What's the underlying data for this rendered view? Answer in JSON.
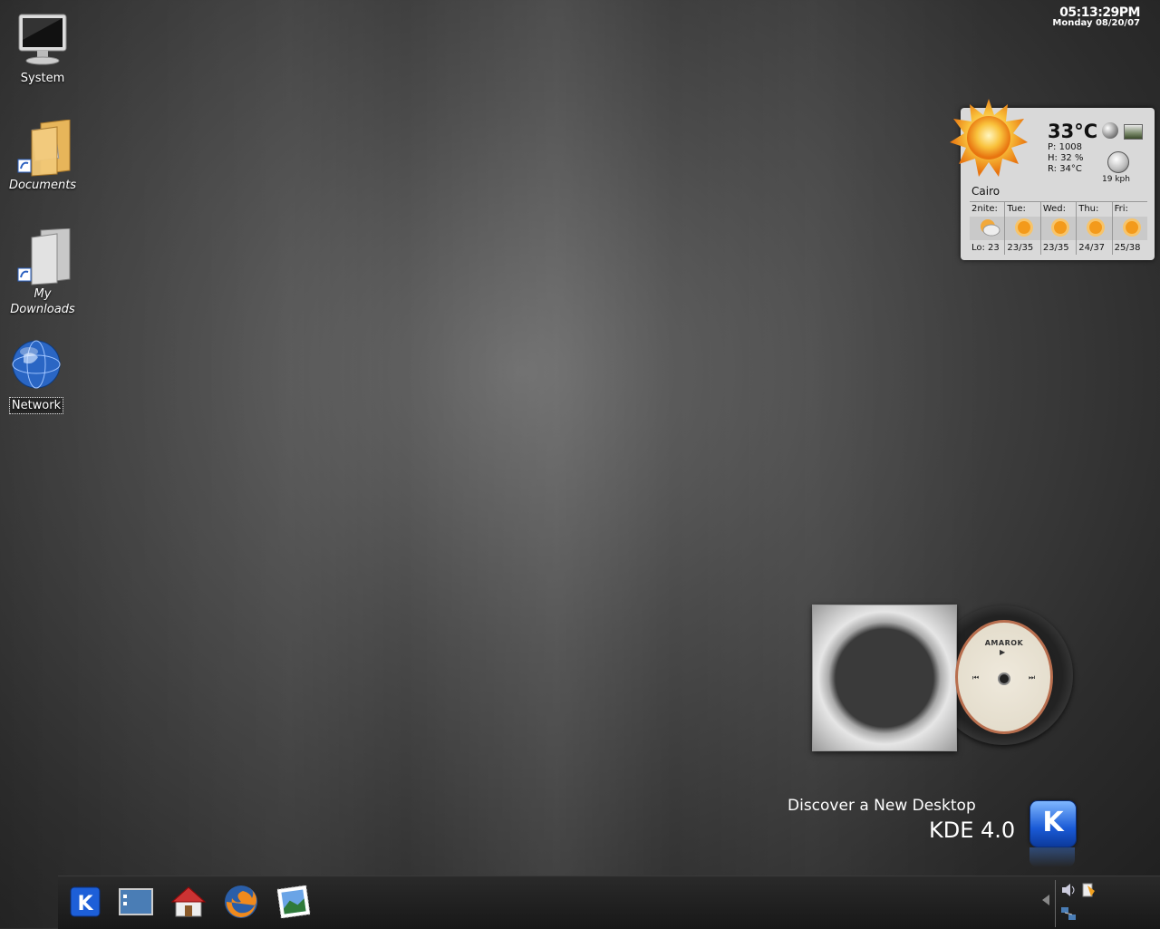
{
  "desktop": {
    "icons": [
      {
        "label": "System"
      },
      {
        "label": "Documents"
      },
      {
        "label": "My Downloads"
      },
      {
        "label": "Network"
      }
    ]
  },
  "clock": {
    "time": "05:13:29PM",
    "date": "Monday 08/20/07"
  },
  "weather": {
    "temperature": "33°C",
    "pressure": "P:  1008",
    "humidity": "H: 32 %",
    "realfeel": "R: 34°C",
    "wind": "19 kph",
    "city": "Cairo",
    "forecast": [
      {
        "day": "2nite:",
        "temp": "Lo: 23",
        "icon": "cloudy-moon-icon"
      },
      {
        "day": "Tue:",
        "temp": "23/35",
        "icon": "sun-icon"
      },
      {
        "day": "Wed:",
        "temp": "23/35",
        "icon": "sun-icon"
      },
      {
        "day": "Thu:",
        "temp": "24/37",
        "icon": "sun-icon"
      },
      {
        "day": "Fri:",
        "temp": "25/38",
        "icon": "sun-icon"
      }
    ]
  },
  "amarok": {
    "title": "AMAROK"
  },
  "promo": {
    "line1": "Discover a New Desktop",
    "line2": "KDE 4.0"
  },
  "colors": {
    "kde_blue": "#1a5ad6",
    "sun_orange": "#f7a21b"
  }
}
